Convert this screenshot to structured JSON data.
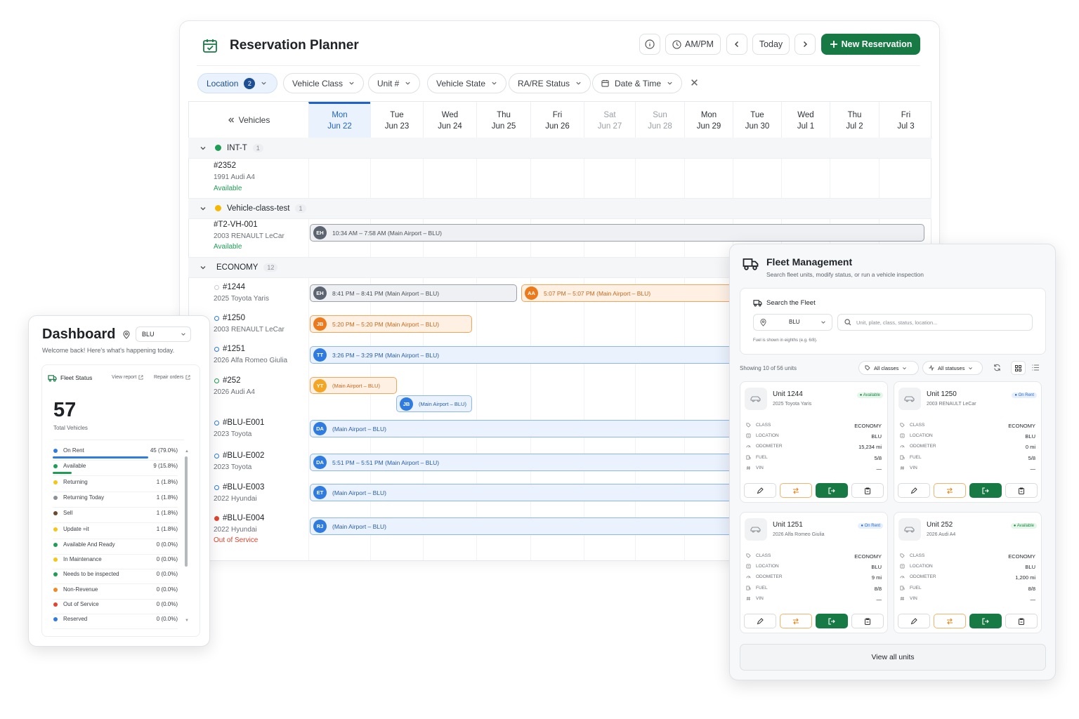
{
  "planner": {
    "title": "Reservation Planner",
    "ampm_label": "AM/PM",
    "today_label": "Today",
    "new_reservation_label": "New Reservation",
    "filters": [
      {
        "label": "Location",
        "badge": "2"
      },
      {
        "label": "Vehicle Class"
      },
      {
        "label": "Unit #"
      },
      {
        "label": "Vehicle State"
      },
      {
        "label": "RA/RE Status"
      },
      {
        "label": "Date & Time"
      }
    ],
    "vehicles_header": "Vehicles",
    "days": [
      {
        "dow": "Mon",
        "date": "Jun 22",
        "state": "active"
      },
      {
        "dow": "Tue",
        "date": "Jun 23",
        "state": "normal"
      },
      {
        "dow": "Wed",
        "date": "Jun 24",
        "state": "normal"
      },
      {
        "dow": "Thu",
        "date": "Jun 25",
        "state": "normal"
      },
      {
        "dow": "Fri",
        "date": "Jun 26",
        "state": "normal"
      },
      {
        "dow": "Sat",
        "date": "Jun 27",
        "state": "weekend"
      },
      {
        "dow": "Sun",
        "date": "Jun 28",
        "state": "weekend"
      },
      {
        "dow": "Mon",
        "date": "Jun 29",
        "state": "normal"
      },
      {
        "dow": "Tue",
        "date": "Jun 30",
        "state": "normal"
      },
      {
        "dow": "Wed",
        "date": "Jul 1",
        "state": "normal"
      },
      {
        "dow": "Thu",
        "date": "Jul 2",
        "state": "normal"
      },
      {
        "dow": "Fri",
        "date": "Jul 3",
        "state": "normal"
      }
    ],
    "groups": [
      {
        "name": "INT-T",
        "count": "1",
        "color": "#1f9d55"
      },
      {
        "name": "Vehicle-class-test",
        "count": "1",
        "color": "#f5b800"
      },
      {
        "name": "ECONOMY",
        "count": "12",
        "color": ""
      }
    ],
    "vehicles": [
      {
        "unit": "#2352",
        "model": "1991 Audi A4",
        "status": "Available",
        "status_color": "#1f9d55",
        "marker": ""
      },
      {
        "unit": "#T2-VH-001",
        "model": "2003 RENAULT LeCar",
        "status": "Available",
        "status_color": "#1f9d55",
        "marker": ""
      },
      {
        "unit": "#1244",
        "model": "2025 Toyota Yaris",
        "status": "",
        "status_color": "",
        "marker": "#c8ccd1"
      },
      {
        "unit": "#1250",
        "model": "2003 RENAULT LeCar",
        "status": "",
        "status_color": "",
        "marker": "#2f7be0"
      },
      {
        "unit": "#1251",
        "model": "2026 Alfa Romeo Giulia",
        "status": "",
        "status_color": "",
        "marker": "#2f7be0"
      },
      {
        "unit": "#252",
        "model": "2026 Audi A4",
        "status": "",
        "status_color": "",
        "marker": "#1f9d55"
      },
      {
        "unit": "#BLU-E001",
        "model": "2023 Toyota",
        "status": "",
        "status_color": "",
        "marker": "#2f7be0"
      },
      {
        "unit": "#BLU-E002",
        "model": "2023 Toyota",
        "status": "",
        "status_color": "",
        "marker": "#2f7be0"
      },
      {
        "unit": "#BLU-E003",
        "model": "2022 Hyundai",
        "status": "",
        "status_color": "",
        "marker": "#2f7be0"
      },
      {
        "unit": "#BLU-E004",
        "model": "2022 Hyundai",
        "status": "Out of Service",
        "status_color": "#e0452f",
        "marker": "#e0452f"
      }
    ],
    "bookings": [
      {
        "initials": "EH",
        "text": "10:34 AM  –  7:58 AM  (Main Airport – BLU)",
        "tone": "grey"
      },
      {
        "initials": "EH",
        "text": "8:41 PM  –  8:41 PM  (Main Airport – BLU)",
        "tone": "grey"
      },
      {
        "initials": "AA",
        "text": "5:07 PM  –  5:07 PM  (Main Airport – BLU)",
        "tone": "orange"
      },
      {
        "initials": "JB",
        "text": "5:20 PM  –  5:20 PM  (Main Airport – BLU)",
        "tone": "orange"
      },
      {
        "initials": "TT",
        "text": "3:26 PM  –  3:29 PM  (Main Airport – BLU)",
        "tone": "blue"
      },
      {
        "initials": "YT",
        "text": "(Main Airport – BLU)",
        "tone": "orange"
      },
      {
        "initials": "JB",
        "text": "(Main Airport – BLU)",
        "tone": "blue"
      },
      {
        "initials": "DA",
        "text": "(Main Airport – BLU)",
        "tone": "blue"
      },
      {
        "initials": "DA",
        "text": "5:51 PM  –  5:51 PM  (Main Airport – BLU)",
        "tone": "blue"
      },
      {
        "initials": "ET",
        "text": "(Main Airport – BLU)",
        "tone": "blue"
      },
      {
        "initials": "RJ",
        "text": "(Main Airport – BLU)",
        "tone": "blue"
      }
    ]
  },
  "dashboard": {
    "title": "Dashboard",
    "location": "BLU",
    "subtitle": "Welcome back! Here's what's happening today.",
    "fleet_status_label": "Fleet Status",
    "view_report_label": "View report",
    "repair_orders_label": "Repair orders",
    "total": "57",
    "total_label": "Total Vehicles",
    "statuses": [
      {
        "label": "On Rent",
        "value": "45 (79.0%)",
        "color": "#2f7be0",
        "fraction": 0.79
      },
      {
        "label": "Available",
        "value": "9 (15.8%)",
        "color": "#1f9d55",
        "fraction": 0.158
      },
      {
        "label": "Returning",
        "value": "1 (1.8%)",
        "color": "#f5c518",
        "fraction": 0.018
      },
      {
        "label": "Returning Today",
        "value": "1 (1.8%)",
        "color": "#8a9096",
        "fraction": 0.018
      },
      {
        "label": "Sell",
        "value": "1 (1.8%)",
        "color": "#6b4a2e",
        "fraction": 0.018
      },
      {
        "label": "Update =it",
        "value": "1 (1.8%)",
        "color": "#f5c518",
        "fraction": 0.018
      },
      {
        "label": "Available And Ready",
        "value": "0 (0.0%)",
        "color": "#1f9d55",
        "fraction": 0
      },
      {
        "label": "In Maintenance",
        "value": "0 (0.0%)",
        "color": "#f5c518",
        "fraction": 0
      },
      {
        "label": "Needs to be inspected",
        "value": "0 (0.0%)",
        "color": "#1f9d55",
        "fraction": 0
      },
      {
        "label": "Non-Revenue",
        "value": "0 (0.0%)",
        "color": "#f08a24",
        "fraction": 0
      },
      {
        "label": "Out of Service",
        "value": "0 (0.0%)",
        "color": "#e0452f",
        "fraction": 0
      },
      {
        "label": "Reserved",
        "value": "0 (0.0%)",
        "color": "#2f7be0",
        "fraction": 0
      }
    ]
  },
  "fleet": {
    "title": "Fleet Management",
    "subtitle": "Search fleet units, modify status, or run a vehicle inspection",
    "search_title": "Search the Fleet",
    "location": "BLU",
    "search_placeholder": "Unit, plate, class, status, location...",
    "fuel_note": "Fuel is shown in eighths (e.g. 6/8).",
    "showing": "Showing 10 of 56 units",
    "class_filter": "All classes",
    "status_filter": "All statuses",
    "field_labels": [
      "Class",
      "Location",
      "Odometer",
      "Fuel",
      "VIN"
    ],
    "units": [
      {
        "name": "Unit 1244",
        "model": "2025 Toyota Yaris",
        "badge": "Available",
        "tone": "green",
        "class": "ECONOMY",
        "location": "BLU",
        "odometer": "15,234 mi",
        "fuel": "5/8",
        "vin": "—"
      },
      {
        "name": "Unit 1250",
        "model": "2003 RENAULT LeCar",
        "badge": "On Rent",
        "tone": "blue",
        "class": "ECONOMY",
        "location": "BLU",
        "odometer": "0 mi",
        "fuel": "5/8",
        "vin": "—"
      },
      {
        "name": "Unit 1251",
        "model": "2026 Alfa Romeo Giulia",
        "badge": "On Rent",
        "tone": "blue",
        "class": "ECONOMY",
        "location": "BLU",
        "odometer": "9 mi",
        "fuel": "8/8",
        "vin": "—"
      },
      {
        "name": "Unit 252",
        "model": "2026 Audi A4",
        "badge": "Available",
        "tone": "green",
        "class": "ECONOMY",
        "location": "BLU",
        "odometer": "1,200 mi",
        "fuel": "8/8",
        "vin": "—"
      }
    ],
    "view_all_label": "View all units"
  }
}
